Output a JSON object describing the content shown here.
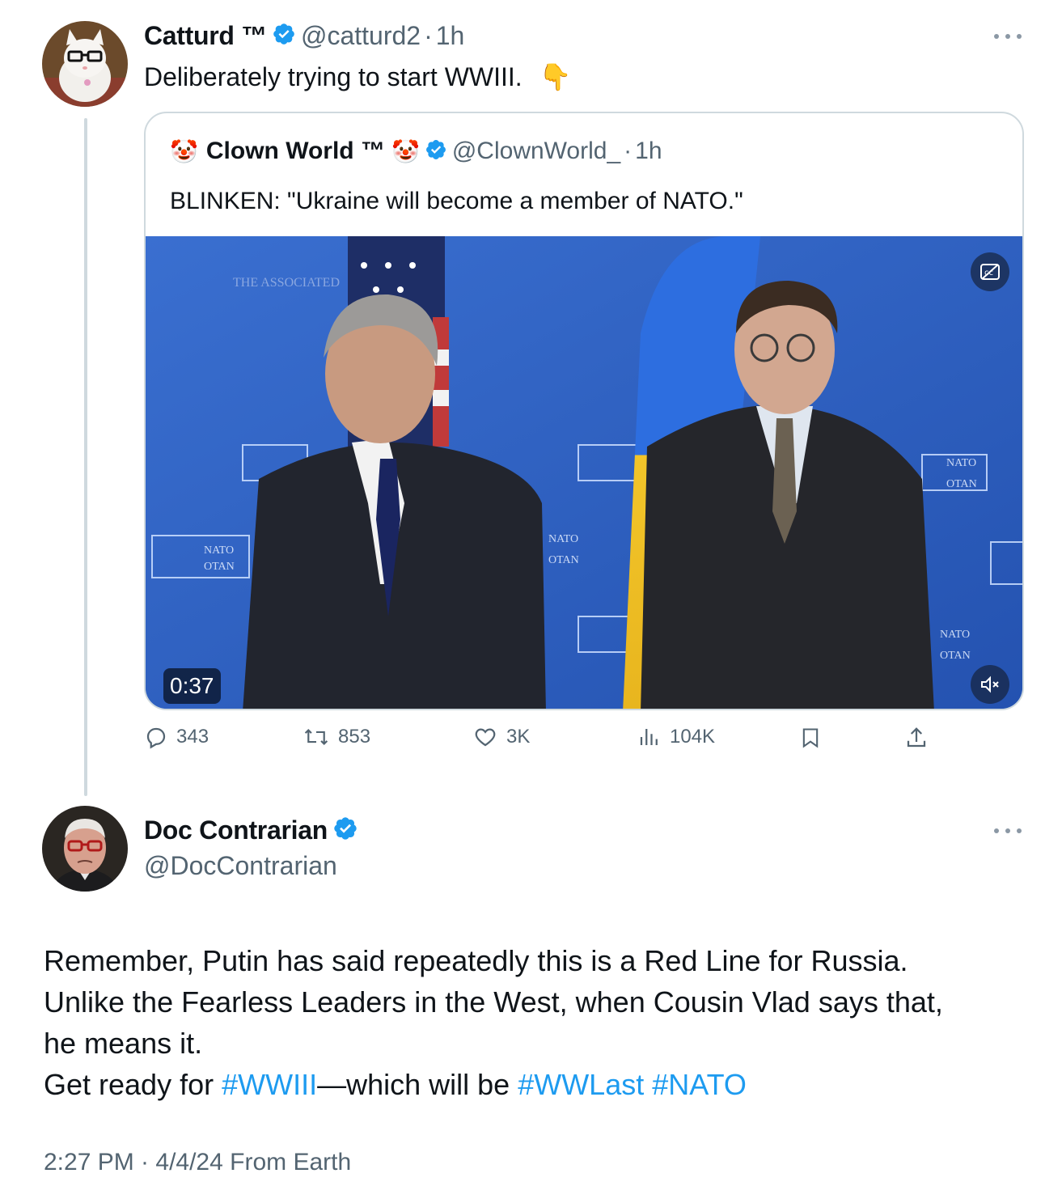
{
  "tweet1": {
    "name": "Catturd ™",
    "handle": "@catturd2",
    "separator": "·",
    "time": "1h",
    "text": "Deliberately trying to start WWIII.",
    "emoji": "👇"
  },
  "quote": {
    "emoji": "🤡",
    "name": "Clown World ™",
    "handle": "@ClownWorld_",
    "separator": "·",
    "time": "1h",
    "text": "BLINKEN: \"Ukraine will become a member of NATO.\"",
    "video": {
      "duration": "0:37",
      "watermark": "THE ASSOCIATED",
      "nato_label": "NATO",
      "otan_label": "OTAN"
    }
  },
  "actions": {
    "replies": "343",
    "reposts": "853",
    "likes": "3K",
    "views": "104K"
  },
  "tweet2": {
    "name": "Doc Contrarian",
    "handle": "@DocContrarian",
    "lines": [
      "Remember, Putin has said repeatedly this is a Red Line for Russia.",
      "Unlike the Fearless Leaders in the West, when Cousin Vlad says that,",
      "he means it."
    ],
    "last_line": {
      "prefix": "Get ready for ",
      "tag1": "#WWIII",
      "middle": "—which will be ",
      "tag2": "#WWLast",
      "space": " ",
      "tag3": "#NATO"
    },
    "meta": "2:27 PM · 4/4/24 From Earth"
  },
  "colors": {
    "link": "#1d9bf0",
    "secondary_text": "#536471",
    "verified": "#1d9bf0",
    "border": "#cfd9de"
  }
}
